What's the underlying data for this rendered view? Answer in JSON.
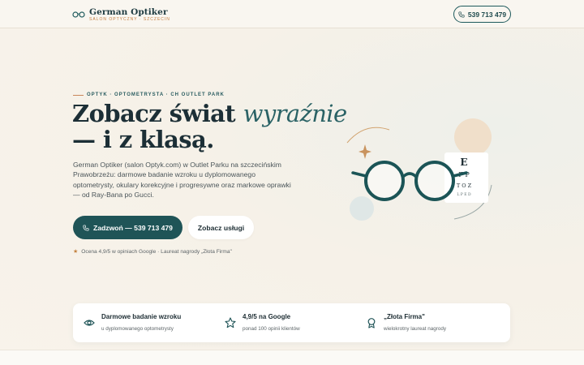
{
  "header": {
    "brand_name": "German Optiker",
    "brand_sub": "SALON OPTYCZNY · SZCZECIN",
    "phone": "539 713 479"
  },
  "hero": {
    "eyebrow": "OPTYK · OPTOMETRYSTA · CH OUTLET PARK",
    "headline_part1": "Zobacz świat ",
    "headline_accent": "wyraźnie",
    "headline_part2": "— i z klasą.",
    "lead": "German Optiker (salon Optyk.com) w Outlet Parku na szczecińskim Prawobrzeżu: darmowe badanie wzroku u dyplomowanego optometrysty, okulary korekcyjne i progresywne oraz markowe oprawki — od Ray-Bana po Gucci.",
    "cta_primary": "Zadzwoń — 539 713 479",
    "cta_secondary": "Zobacz usługi",
    "rating": "Ocena 4,9/5 w opiniach Google · Laureat nagrody „Złota Firma\""
  },
  "eye_chart": {
    "rows": [
      "E",
      "F P",
      "T O Z",
      "L P E D"
    ]
  },
  "features": [
    {
      "icon": "eye-icon",
      "title": "Darmowe badanie wzroku",
      "sub": "u dyplomowanego optometrysty"
    },
    {
      "icon": "star-icon",
      "title": "4,9/5 na Google",
      "sub": "ponad 100 opinii klientów"
    },
    {
      "icon": "award-icon",
      "title": "„Złota Firma\"",
      "sub": "wielokrotny laureat nagrody"
    }
  ],
  "colors": {
    "brand_dark": "#1f5457",
    "accent_copper": "#c47d3e",
    "background": "#f7f2ea"
  }
}
